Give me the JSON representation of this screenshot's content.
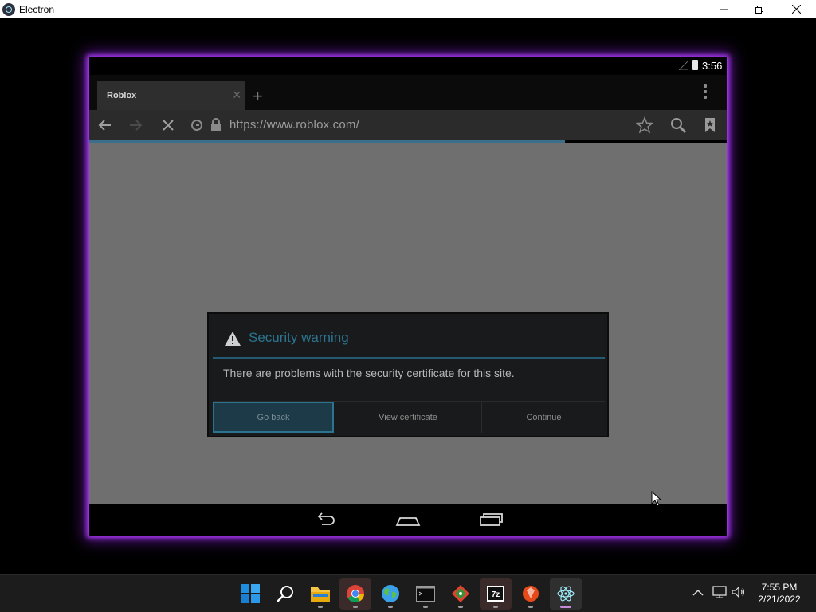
{
  "window": {
    "title": "Electron"
  },
  "android": {
    "status_time": "3:56",
    "tab": {
      "title": "Roblox"
    },
    "url": "https://www.roblox.com/",
    "dialog": {
      "title": "Security warning",
      "message": "There are problems with the security certificate for this site.",
      "buttons": {
        "back": "Go back",
        "view_certificate": "View certificate",
        "continue": "Continue"
      }
    }
  },
  "taskbar": {
    "apps": [
      "windows-start",
      "search",
      "file-explorer",
      "chrome",
      "globe-app",
      "terminal",
      "git",
      "7zip",
      "ruby",
      "electron"
    ],
    "time": "7:55 PM",
    "date": "2/21/2022"
  },
  "colors": {
    "glow": "#b13cff",
    "dialog_accent": "#2c7490"
  }
}
